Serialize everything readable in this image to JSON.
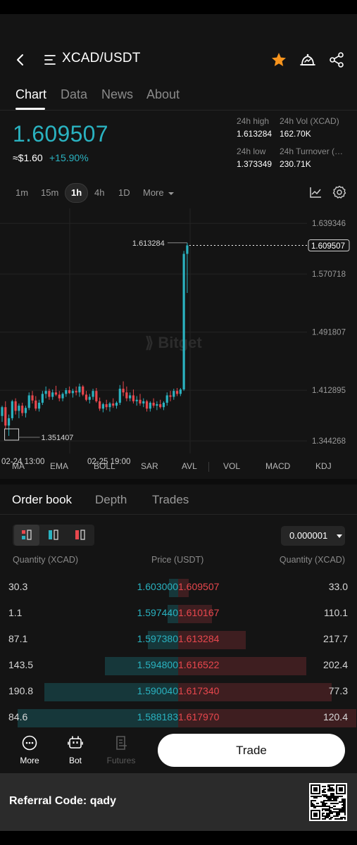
{
  "header": {
    "pair": "XCAD/USDT",
    "back_icon": "back-arrow-icon",
    "menu_icon": "list-menu-icon",
    "favorite_icon": "star-icon",
    "alert_icon": "price-alert-icon",
    "share_icon": "share-icon",
    "accent_color": "#f7941d"
  },
  "tabs": [
    {
      "label": "Chart",
      "active": true
    },
    {
      "label": "Data",
      "active": false
    },
    {
      "label": "News",
      "active": false
    },
    {
      "label": "About",
      "active": false
    }
  ],
  "ticker": {
    "last_price": "1.609507",
    "usd_price": "≈$1.60",
    "change_pct": "+15.90%",
    "high_label": "24h high",
    "high_value": "1.613284",
    "vol_label": "24h Vol (XCAD)",
    "vol_value": "162.70K",
    "low_label": "24h low",
    "low_value": "1.373349",
    "turnover_label": "24h Turnover (…",
    "turnover_value": "230.71K",
    "up_color": "#2ab2c0",
    "down_color": "#e8474d"
  },
  "timeframes": {
    "items": [
      "1m",
      "15m",
      "1h",
      "4h",
      "1D"
    ],
    "active": "1h",
    "more_label": "More",
    "chart_type_icon": "line-chart-icon",
    "settings_icon": "gear-icon"
  },
  "chart_data": {
    "type": "candlestick",
    "watermark": "Bitget",
    "y_ticks": [
      "1.639346",
      "1.570718",
      "1.491807",
      "1.412895",
      "1.344268"
    ],
    "x_ticks": [
      "02-24 13:00",
      "02-25 19:00"
    ],
    "high_marker": "1.613284",
    "low_marker": "1.351407",
    "last_price_label": "1.609507",
    "candles": [
      [
        1.378,
        1.392,
        1.37,
        1.39
      ],
      [
        1.39,
        1.398,
        1.36,
        1.365
      ],
      [
        1.365,
        1.38,
        1.351,
        1.375
      ],
      [
        1.375,
        1.4,
        1.372,
        1.398
      ],
      [
        1.398,
        1.402,
        1.38,
        1.385
      ],
      [
        1.385,
        1.395,
        1.375,
        1.392
      ],
      [
        1.392,
        1.396,
        1.378,
        1.382
      ],
      [
        1.382,
        1.392,
        1.376,
        1.389
      ],
      [
        1.389,
        1.41,
        1.386,
        1.406
      ],
      [
        1.406,
        1.412,
        1.395,
        1.399
      ],
      [
        1.399,
        1.405,
        1.385,
        1.388
      ],
      [
        1.388,
        1.4,
        1.384,
        1.396
      ],
      [
        1.396,
        1.412,
        1.393,
        1.408
      ],
      [
        1.408,
        1.418,
        1.402,
        1.412
      ],
      [
        1.412,
        1.415,
        1.4,
        1.404
      ],
      [
        1.404,
        1.414,
        1.4,
        1.41
      ],
      [
        1.41,
        1.419,
        1.405,
        1.407
      ],
      [
        1.407,
        1.412,
        1.398,
        1.402
      ],
      [
        1.402,
        1.41,
        1.398,
        1.408
      ],
      [
        1.408,
        1.416,
        1.404,
        1.413
      ],
      [
        1.413,
        1.418,
        1.408,
        1.409
      ],
      [
        1.409,
        1.415,
        1.403,
        1.412
      ],
      [
        1.412,
        1.418,
        1.406,
        1.41
      ],
      [
        1.41,
        1.422,
        1.404,
        1.418
      ],
      [
        1.418,
        1.42,
        1.405,
        1.407
      ],
      [
        1.407,
        1.412,
        1.398,
        1.4
      ],
      [
        1.4,
        1.408,
        1.395,
        1.404
      ],
      [
        1.404,
        1.415,
        1.4,
        1.412
      ],
      [
        1.412,
        1.416,
        1.396,
        1.398
      ],
      [
        1.398,
        1.403,
        1.385,
        1.388
      ],
      [
        1.388,
        1.396,
        1.383,
        1.394
      ],
      [
        1.394,
        1.4,
        1.386,
        1.39
      ],
      [
        1.39,
        1.397,
        1.384,
        1.395
      ],
      [
        1.395,
        1.402,
        1.389,
        1.392
      ],
      [
        1.392,
        1.398,
        1.388,
        1.396
      ],
      [
        1.396,
        1.42,
        1.393,
        1.415
      ],
      [
        1.415,
        1.425,
        1.405,
        1.41
      ],
      [
        1.41,
        1.418,
        1.398,
        1.402
      ],
      [
        1.402,
        1.41,
        1.398,
        1.406
      ],
      [
        1.406,
        1.414,
        1.395,
        1.398
      ],
      [
        1.398,
        1.405,
        1.392,
        1.4
      ],
      [
        1.4,
        1.408,
        1.392,
        1.395
      ],
      [
        1.395,
        1.402,
        1.39,
        1.398
      ],
      [
        1.398,
        1.4,
        1.384,
        1.388
      ],
      [
        1.388,
        1.398,
        1.384,
        1.396
      ],
      [
        1.396,
        1.402,
        1.389,
        1.392
      ],
      [
        1.392,
        1.398,
        1.386,
        1.394
      ],
      [
        1.394,
        1.4,
        1.388,
        1.39
      ],
      [
        1.39,
        1.398,
        1.386,
        1.396
      ],
      [
        1.396,
        1.41,
        1.392,
        1.406
      ],
      [
        1.406,
        1.412,
        1.398,
        1.404
      ],
      [
        1.404,
        1.415,
        1.4,
        1.412
      ],
      [
        1.412,
        1.416,
        1.405,
        1.408
      ],
      [
        1.408,
        1.416,
        1.405,
        1.414
      ],
      [
        1.414,
        1.602,
        1.412,
        1.598
      ],
      [
        1.598,
        1.613,
        1.545,
        1.6095
      ]
    ],
    "y_range": [
      1.33,
      1.652
    ]
  },
  "indicators": [
    "MA",
    "EMA",
    "BOLL",
    "SAR",
    "AVL",
    "VOL",
    "MACD",
    "KDJ"
  ],
  "orderbook": {
    "tabs": [
      {
        "label": "Order book",
        "active": true
      },
      {
        "label": "Depth",
        "active": false
      },
      {
        "label": "Trades",
        "active": false
      }
    ],
    "precision": "0.000001",
    "col_qty_left": "Quantity (XCAD)",
    "col_price": "Price (USDT)",
    "col_qty_right": "Quantity (XCAD)",
    "rows": [
      {
        "bid_qty": "30.3",
        "bid_price": "1.603000",
        "ask_price": "1.609507",
        "ask_qty": "33.0",
        "bid_depth": 0.05,
        "ask_depth": 0.06
      },
      {
        "bid_qty": "1.1",
        "bid_price": "1.597440",
        "ask_price": "1.610167",
        "ask_qty": "110.1",
        "bid_depth": 0.06,
        "ask_depth": 0.19
      },
      {
        "bid_qty": "87.1",
        "bid_price": "1.597380",
        "ask_price": "1.613284",
        "ask_qty": "217.7",
        "bid_depth": 0.17,
        "ask_depth": 0.38
      },
      {
        "bid_qty": "143.5",
        "bid_price": "1.594800",
        "ask_price": "1.616522",
        "ask_qty": "202.4",
        "bid_depth": 0.41,
        "ask_depth": 0.72
      },
      {
        "bid_qty": "190.8",
        "bid_price": "1.590040",
        "ask_price": "1.617340",
        "ask_qty": "77.3",
        "bid_depth": 0.75,
        "ask_depth": 0.86
      },
      {
        "bid_qty": "84.6",
        "bid_price": "1.588183",
        "ask_price": "1.617970",
        "ask_qty": "120.4",
        "bid_depth": 0.9,
        "ask_depth": 1.0
      }
    ]
  },
  "bottom_nav": {
    "more_label": "More",
    "bot_label": "Bot",
    "futures_label": "Futures",
    "trade_label": "Trade"
  },
  "referral": {
    "text": "Referral Code: qady",
    "qr_icon": "qr-code-icon"
  }
}
